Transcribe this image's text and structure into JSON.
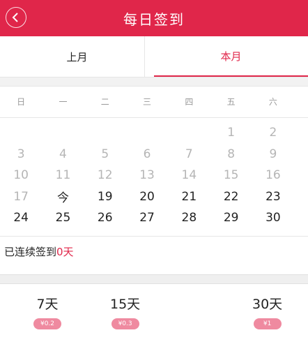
{
  "header": {
    "title": "每日签到"
  },
  "tabs": [
    {
      "label": "上月"
    },
    {
      "label": "本月"
    }
  ],
  "weekdays": [
    "日",
    "一",
    "二",
    "三",
    "四",
    "五",
    "六"
  ],
  "calendar": {
    "rows": [
      [
        "",
        "",
        "",
        "",
        "",
        "1",
        "2"
      ],
      [
        "3",
        "4",
        "5",
        "6",
        "7",
        "8",
        "9"
      ],
      [
        "10",
        "11",
        "12",
        "13",
        "14",
        "15",
        "16"
      ],
      [
        "17",
        "今",
        "19",
        "20",
        "21",
        "22",
        "23"
      ],
      [
        "24",
        "25",
        "26",
        "27",
        "28",
        "29",
        "30"
      ]
    ]
  },
  "status": {
    "prefix": "已连续签到",
    "count": "0天"
  },
  "rewards": [
    {
      "days": "7天",
      "amount": "¥0.2"
    },
    {
      "days": "15天",
      "amount": "¥0.3"
    },
    {
      "days": "30天",
      "amount": "¥1"
    }
  ],
  "colors": {
    "accent": "#e0264a",
    "pill": "#ef8aa0"
  }
}
